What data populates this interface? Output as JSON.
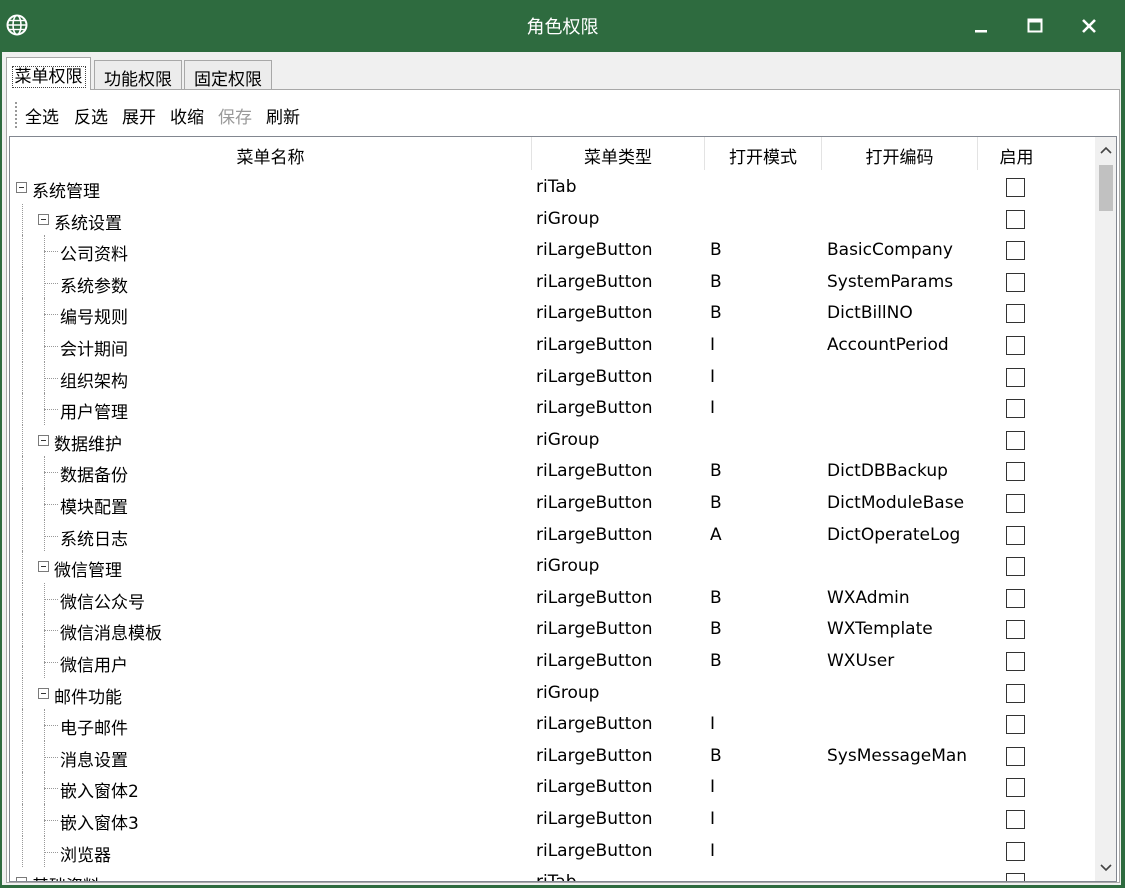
{
  "window": {
    "title": "角色权限",
    "controls": [
      "minimize",
      "maximize",
      "close"
    ]
  },
  "tabs": [
    {
      "label": "菜单权限",
      "active": true
    },
    {
      "label": "功能权限",
      "active": false
    },
    {
      "label": "固定权限",
      "active": false
    }
  ],
  "toolbar": {
    "select_all": "全选",
    "invert": "反选",
    "expand": "展开",
    "collapse": "收缩",
    "save": "保存",
    "refresh": "刷新"
  },
  "grid": {
    "columns": [
      "菜单名称",
      "菜单类型",
      "打开模式",
      "打开编码",
      "启用"
    ],
    "rows": [
      {
        "level": 0,
        "name": "系统管理",
        "type": "riTab",
        "mode": "",
        "code": "",
        "enabled": false
      },
      {
        "level": 1,
        "name": "系统设置",
        "type": "riGroup",
        "mode": "",
        "code": "",
        "enabled": false
      },
      {
        "level": 2,
        "name": "公司资料",
        "type": "riLargeButton",
        "mode": "B",
        "code": "BasicCompany",
        "enabled": false
      },
      {
        "level": 2,
        "name": "系统参数",
        "type": "riLargeButton",
        "mode": "B",
        "code": "SystemParams",
        "enabled": false
      },
      {
        "level": 2,
        "name": "编号规则",
        "type": "riLargeButton",
        "mode": "B",
        "code": "DictBillNO",
        "enabled": false
      },
      {
        "level": 2,
        "name": "会计期间",
        "type": "riLargeButton",
        "mode": "I",
        "code": "AccountPeriod",
        "enabled": false
      },
      {
        "level": 2,
        "name": "组织架构",
        "type": "riLargeButton",
        "mode": "I",
        "code": "",
        "enabled": false
      },
      {
        "level": 2,
        "name": "用户管理",
        "type": "riLargeButton",
        "mode": "I",
        "code": "",
        "enabled": false
      },
      {
        "level": 1,
        "name": "数据维护",
        "type": "riGroup",
        "mode": "",
        "code": "",
        "enabled": false
      },
      {
        "level": 2,
        "name": "数据备份",
        "type": "riLargeButton",
        "mode": "B",
        "code": "DictDBBackup",
        "enabled": false
      },
      {
        "level": 2,
        "name": "模块配置",
        "type": "riLargeButton",
        "mode": "B",
        "code": "DictModuleBase",
        "enabled": false
      },
      {
        "level": 2,
        "name": "系统日志",
        "type": "riLargeButton",
        "mode": "A",
        "code": "DictOperateLog",
        "enabled": false
      },
      {
        "level": 1,
        "name": "微信管理",
        "type": "riGroup",
        "mode": "",
        "code": "",
        "enabled": false
      },
      {
        "level": 2,
        "name": "微信公众号",
        "type": "riLargeButton",
        "mode": "B",
        "code": "WXAdmin",
        "enabled": false
      },
      {
        "level": 2,
        "name": "微信消息模板",
        "type": "riLargeButton",
        "mode": "B",
        "code": "WXTemplate",
        "enabled": false
      },
      {
        "level": 2,
        "name": "微信用户",
        "type": "riLargeButton",
        "mode": "B",
        "code": "WXUser",
        "enabled": false
      },
      {
        "level": 1,
        "name": "邮件功能",
        "type": "riGroup",
        "mode": "",
        "code": "",
        "enabled": false
      },
      {
        "level": 2,
        "name": "电子邮件",
        "type": "riLargeButton",
        "mode": "I",
        "code": "",
        "enabled": false
      },
      {
        "level": 2,
        "name": "消息设置",
        "type": "riLargeButton",
        "mode": "B",
        "code": "SysMessageMan",
        "enabled": false
      },
      {
        "level": 2,
        "name": "嵌入窗体2",
        "type": "riLargeButton",
        "mode": "I",
        "code": "",
        "enabled": false
      },
      {
        "level": 2,
        "name": "嵌入窗体3",
        "type": "riLargeButton",
        "mode": "I",
        "code": "",
        "enabled": false
      },
      {
        "level": 2,
        "name": "浏览器",
        "type": "riLargeButton",
        "mode": "I",
        "code": "",
        "enabled": false
      },
      {
        "level": 0,
        "name": "基础资料",
        "type": "riTab",
        "mode": "",
        "code": "",
        "enabled": false
      }
    ]
  },
  "colors": {
    "titlebar": "#2e6b3f",
    "toolbar_disabled": "#9a9a9a"
  }
}
